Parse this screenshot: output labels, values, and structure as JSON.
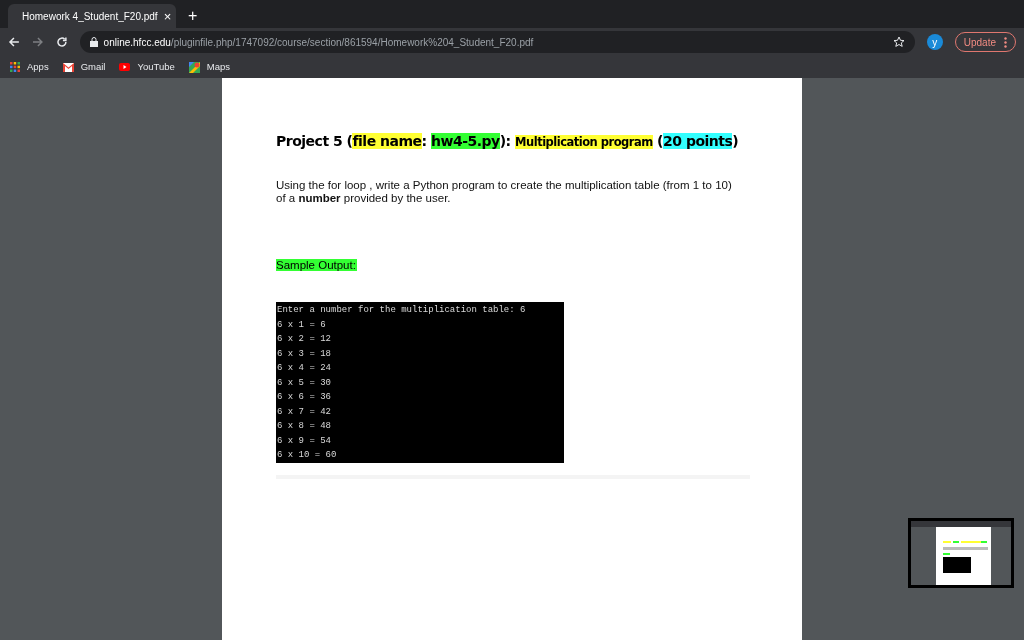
{
  "tab": {
    "title": "Homework 4_Student_F20.pdf",
    "close": "×",
    "new_tab": "+"
  },
  "address": {
    "host": "online.hfcc.edu",
    "path": "/pluginfile.php/1747092/course/section/861594/Homework%204_Student_F20.pdf"
  },
  "profile": "y",
  "update_button": "Update",
  "bookmarks": [
    {
      "label": "Apps",
      "kind": "apps"
    },
    {
      "label": "Gmail",
      "kind": "gmail"
    },
    {
      "label": "YouTube",
      "kind": "youtube"
    },
    {
      "label": "Maps",
      "kind": "maps"
    }
  ],
  "document": {
    "heading": [
      {
        "text": "Project 5 ("
      },
      {
        "text": "file name",
        "color": "#ffff33"
      },
      {
        "text": ": "
      },
      {
        "text": "hw4-5.py",
        "color": "#33ff33"
      },
      {
        "text": "): "
      },
      {
        "text": "Multiplication program",
        "color": "#ffff33",
        "small": true
      },
      {
        "text": " ("
      },
      {
        "text": "20 points",
        "color": "#33ffff"
      },
      {
        "text": ")"
      }
    ],
    "paragraph": "Using the for loop , write a Python program to create the multiplication table (from 1 to 10) of a **number** provided by the user.",
    "sample_label": "Sample Output:",
    "console_lines": [
      "Enter a number for the multiplication table: 6",
      "6 x 1 = 6",
      "6 x 2 = 12",
      "6 x 3 = 18",
      "6 x 4 = 24",
      "6 x 5 = 30",
      "6 x 6 = 36",
      "6 x 7 = 42",
      "6 x 8 = 48",
      "6 x 9 = 54",
      "6 x 10 = 60"
    ]
  }
}
